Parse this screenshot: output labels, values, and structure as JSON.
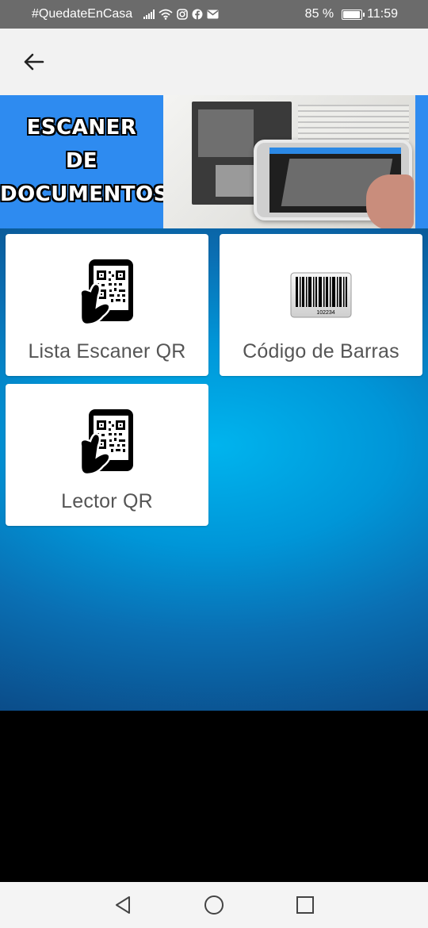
{
  "status_bar": {
    "carrier_text": "#QuedateEnCasa",
    "battery_percent": "85 %",
    "battery_level": 0.85,
    "time": "11:59",
    "icons": [
      "signal-icon",
      "wifi-icon",
      "instagram-icon",
      "facebook-icon",
      "mail-icon",
      "battery-icon"
    ]
  },
  "app_bar": {
    "back_icon": "arrow-left-icon"
  },
  "banner": {
    "title_lines": [
      "ESCANER",
      "DE",
      "DOCUMENTOS"
    ],
    "background_color": "#2e8bf0"
  },
  "menu": {
    "items": [
      {
        "label": "Lista Escaner QR",
        "icon": "qr-phone-hand-icon"
      },
      {
        "label": "Código de Barras",
        "icon": "barcode-icon",
        "barcode_number": "102234"
      },
      {
        "label": "Lector QR",
        "icon": "qr-phone-hand-icon"
      }
    ]
  },
  "nav_bar": {
    "icons": [
      "nav-back-icon",
      "nav-home-icon",
      "nav-recent-icon"
    ]
  },
  "colors": {
    "main_gradient_center": "#00b4ee",
    "main_gradient_edge": "#0b4d8a",
    "card_label": "#555555"
  }
}
